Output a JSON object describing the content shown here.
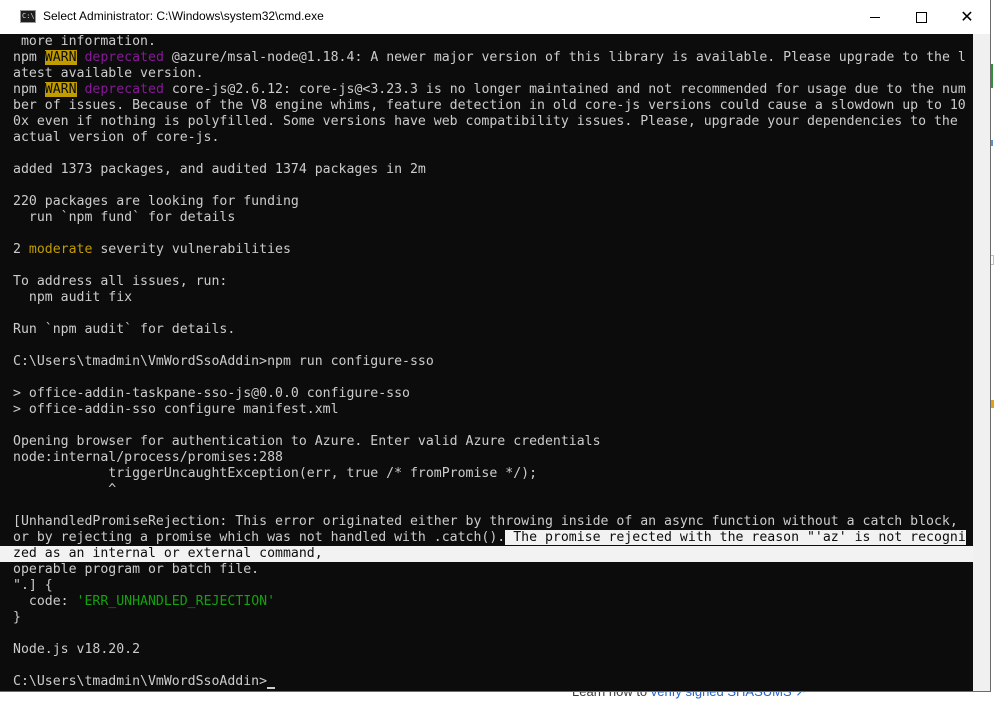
{
  "window": {
    "title": "Select Administrator:  C:\\Windows\\system32\\cmd.exe",
    "icon": "cmd-icon",
    "controls": {
      "minimize": "minimize-icon",
      "maximize": "maximize-icon",
      "close": "✕"
    }
  },
  "console": {
    "lines": [
      " more information.",
      {
        "pre": "npm ",
        "warn": "WARN",
        "sp": " ",
        "depr": "deprecated",
        "rest": " @azure/msal-node@1.18.4: A newer major version of this library is available. Please upgrade to the l"
      },
      "atest available version.",
      {
        "pre": "npm ",
        "warn": "WARN",
        "sp": " ",
        "depr": "deprecated",
        "rest": " core-js@2.6.12: core-js@<3.23.3 is no longer maintained and not recommended for usage due to the num"
      },
      "ber of issues. Because of the V8 engine whims, feature detection in old core-js versions could cause a slowdown up to 10",
      "0x even if nothing is polyfilled. Some versions have web compatibility issues. Please, upgrade your dependencies to the",
      "actual version of core-js.",
      "",
      "added 1373 packages, and audited 1374 packages in 2m",
      "",
      "220 packages are looking for funding",
      "  run `npm fund` for details",
      "",
      {
        "pre": "2 ",
        "mod": "moderate",
        "rest": " severity vulnerabilities"
      },
      "",
      "To address all issues, run:",
      "  npm audit fix",
      "",
      "Run `npm audit` for details.",
      "",
      "C:\\Users\\tmadmin\\VmWordSsoAddin>npm run configure-sso",
      "",
      "> office-addin-taskpane-sso-js@0.0.0 configure-sso",
      "> office-addin-sso configure manifest.xml",
      "",
      "Opening browser for authentication to Azure. Enter valid Azure credentials",
      "node:internal/process/promises:288",
      "            triggerUncaughtException(err, true /* fromPromise */);",
      "            ^",
      "",
      "[UnhandledPromiseRejection: This error originated either by throwing inside of an async function without a catch block,",
      {
        "pre": "or by rejecting a promise which was not handled with .catch().",
        "sel": " The promise rejected with the reason \"'az' is not recogni"
      },
      "zed as an internal or external command,",
      "operable program or batch file.",
      "\".] {",
      {
        "pre": "  code: ",
        "green": "'ERR_UNHANDLED_REJECTION'"
      },
      "}",
      "",
      "Node.js v18.20.2",
      "",
      "C:\\Users\\tmadmin\\VmWordSsoAddin>"
    ]
  },
  "background": {
    "link_text_pre": "Learn how to ",
    "link_text": "verify signed SHASUMS",
    "link_arrow": "↗"
  },
  "colors": {
    "console_bg": "#0c0c0c",
    "console_fg": "#cccccc",
    "warn_bg": "#c19c00",
    "deprecated": "#881798",
    "moderate": "#c19c00",
    "string_green": "#13a10e",
    "selection_bg": "#f2f2f2"
  }
}
